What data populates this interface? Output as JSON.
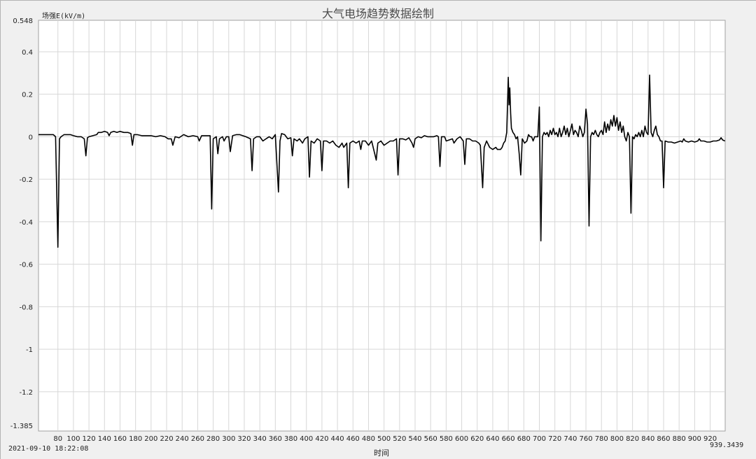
{
  "window": {
    "title": "大气电场趋势数据绘制",
    "timestamp": "2021-09-10 18:22:08"
  },
  "colors": {
    "background": "#f0f0f0",
    "plot_background": "#ffffff",
    "grid": "#d7d7d7",
    "line": "#000000"
  },
  "chart_data": {
    "type": "line",
    "title": "大气电场趋势数据绘制",
    "ylabel": "场强E(kV/m)",
    "xlabel": "时间",
    "xlim": [
      55,
      939.3439
    ],
    "ylim": [
      -1.385,
      0.548
    ],
    "x_max_label": "939.3439",
    "y_top_label": "0.548",
    "y_bottom_label": "-1.385",
    "x_ticks": [
      80,
      100,
      120,
      140,
      160,
      180,
      200,
      220,
      240,
      260,
      280,
      300,
      320,
      340,
      360,
      380,
      400,
      420,
      440,
      460,
      480,
      500,
      520,
      540,
      560,
      580,
      600,
      620,
      640,
      660,
      680,
      700,
      720,
      740,
      760,
      780,
      800,
      820,
      840,
      860,
      880,
      900,
      920
    ],
    "y_ticks": [
      0.4,
      0.2,
      0,
      -0.2,
      -0.4,
      -0.6,
      -0.8,
      -1,
      -1.2
    ],
    "y_tick_labels": [
      "0.4",
      "0.2",
      "0",
      "-0.2",
      "-0.4",
      "-0.6",
      "-0.8",
      "-1",
      "-1.2"
    ],
    "grid": true,
    "series": [
      {
        "points": [
          [
            55,
            0.01
          ],
          [
            60,
            0.01
          ],
          [
            65,
            0.01
          ],
          [
            70,
            0.01
          ],
          [
            74,
            0.01
          ],
          [
            77,
            0.0
          ],
          [
            80,
            -0.52
          ],
          [
            82,
            -0.01
          ],
          [
            84,
            0.0
          ],
          [
            88,
            0.01
          ],
          [
            92,
            0.01
          ],
          [
            96,
            0.01
          ],
          [
            100,
            0.005
          ],
          [
            105,
            0.0
          ],
          [
            110,
            0.0
          ],
          [
            114,
            -0.01
          ],
          [
            116,
            -0.09
          ],
          [
            118,
            -0.005
          ],
          [
            120,
            0.0
          ],
          [
            125,
            0.005
          ],
          [
            130,
            0.01
          ],
          [
            132,
            0.02
          ],
          [
            136,
            0.02
          ],
          [
            140,
            0.025
          ],
          [
            144,
            0.02
          ],
          [
            146,
            0.005
          ],
          [
            148,
            0.02
          ],
          [
            152,
            0.025
          ],
          [
            156,
            0.02
          ],
          [
            160,
            0.025
          ],
          [
            165,
            0.02
          ],
          [
            170,
            0.02
          ],
          [
            174,
            0.015
          ],
          [
            176,
            -0.04
          ],
          [
            178,
            0.01
          ],
          [
            182,
            0.01
          ],
          [
            188,
            0.005
          ],
          [
            194,
            0.005
          ],
          [
            200,
            0.005
          ],
          [
            206,
            0.0
          ],
          [
            212,
            0.005
          ],
          [
            218,
            0.0
          ],
          [
            222,
            -0.01
          ],
          [
            226,
            -0.01
          ],
          [
            228,
            -0.04
          ],
          [
            231,
            0.0
          ],
          [
            236,
            -0.005
          ],
          [
            242,
            0.01
          ],
          [
            248,
            0.0
          ],
          [
            254,
            0.005
          ],
          [
            260,
            0.0
          ],
          [
            262,
            -0.02
          ],
          [
            265,
            0.005
          ],
          [
            270,
            0.005
          ],
          [
            276,
            0.005
          ],
          [
            278,
            -0.34
          ],
          [
            280,
            -0.01
          ],
          [
            284,
            0.0
          ],
          [
            286,
            -0.08
          ],
          [
            288,
            -0.01
          ],
          [
            292,
            0.0
          ],
          [
            294,
            -0.02
          ],
          [
            297,
            0.0
          ],
          [
            300,
            0.0
          ],
          [
            302,
            -0.07
          ],
          [
            305,
            0.005
          ],
          [
            310,
            0.01
          ],
          [
            314,
            0.01
          ],
          [
            318,
            0.005
          ],
          [
            322,
            0.0
          ],
          [
            328,
            -0.01
          ],
          [
            330,
            -0.16
          ],
          [
            332,
            -0.01
          ],
          [
            336,
            0.0
          ],
          [
            340,
            0.0
          ],
          [
            344,
            -0.02
          ],
          [
            348,
            -0.01
          ],
          [
            352,
            0.0
          ],
          [
            356,
            -0.01
          ],
          [
            360,
            0.01
          ],
          [
            364,
            -0.26
          ],
          [
            366,
            -0.02
          ],
          [
            368,
            0.015
          ],
          [
            372,
            0.01
          ],
          [
            376,
            -0.01
          ],
          [
            380,
            -0.005
          ],
          [
            382,
            -0.09
          ],
          [
            384,
            -0.01
          ],
          [
            388,
            -0.02
          ],
          [
            391,
            -0.01
          ],
          [
            395,
            -0.03
          ],
          [
            398,
            -0.01
          ],
          [
            402,
            0.0
          ],
          [
            404,
            -0.19
          ],
          [
            406,
            -0.02
          ],
          [
            410,
            -0.03
          ],
          [
            414,
            -0.01
          ],
          [
            418,
            -0.02
          ],
          [
            420,
            -0.16
          ],
          [
            422,
            -0.02
          ],
          [
            426,
            -0.02
          ],
          [
            430,
            -0.03
          ],
          [
            434,
            -0.02
          ],
          [
            438,
            -0.04
          ],
          [
            442,
            -0.05
          ],
          [
            446,
            -0.03
          ],
          [
            448,
            -0.05
          ],
          [
            452,
            -0.03
          ],
          [
            454,
            -0.24
          ],
          [
            456,
            -0.03
          ],
          [
            460,
            -0.02
          ],
          [
            464,
            -0.03
          ],
          [
            468,
            -0.02
          ],
          [
            470,
            -0.06
          ],
          [
            472,
            -0.02
          ],
          [
            476,
            -0.02
          ],
          [
            480,
            -0.04
          ],
          [
            484,
            -0.02
          ],
          [
            488,
            -0.08
          ],
          [
            490,
            -0.11
          ],
          [
            492,
            -0.03
          ],
          [
            496,
            -0.02
          ],
          [
            500,
            -0.04
          ],
          [
            504,
            -0.03
          ],
          [
            508,
            -0.02
          ],
          [
            512,
            -0.02
          ],
          [
            516,
            -0.01
          ],
          [
            518,
            -0.18
          ],
          [
            520,
            -0.01
          ],
          [
            524,
            -0.01
          ],
          [
            528,
            -0.015
          ],
          [
            532,
            -0.005
          ],
          [
            536,
            -0.03
          ],
          [
            538,
            -0.05
          ],
          [
            540,
            -0.01
          ],
          [
            544,
            0.0
          ],
          [
            548,
            -0.005
          ],
          [
            552,
            0.005
          ],
          [
            556,
            0.0
          ],
          [
            560,
            0.0
          ],
          [
            564,
            0.0
          ],
          [
            568,
            0.005
          ],
          [
            570,
            0.0
          ],
          [
            572,
            -0.14
          ],
          [
            574,
            0.0
          ],
          [
            578,
            0.0
          ],
          [
            580,
            -0.02
          ],
          [
            584,
            -0.015
          ],
          [
            588,
            -0.01
          ],
          [
            590,
            -0.03
          ],
          [
            594,
            -0.01
          ],
          [
            598,
            0.0
          ],
          [
            602,
            -0.02
          ],
          [
            604,
            -0.13
          ],
          [
            606,
            -0.01
          ],
          [
            610,
            -0.01
          ],
          [
            614,
            -0.02
          ],
          [
            618,
            -0.02
          ],
          [
            622,
            -0.03
          ],
          [
            624,
            -0.04
          ],
          [
            627,
            -0.24
          ],
          [
            629,
            -0.05
          ],
          [
            632,
            -0.02
          ],
          [
            636,
            -0.05
          ],
          [
            640,
            -0.06
          ],
          [
            644,
            -0.05
          ],
          [
            646,
            -0.06
          ],
          [
            650,
            -0.06
          ],
          [
            652,
            -0.05
          ],
          [
            654,
            -0.03
          ],
          [
            656,
            -0.02
          ],
          [
            658,
            0.02
          ],
          [
            660,
            0.28
          ],
          [
            661,
            0.15
          ],
          [
            662,
            0.23
          ],
          [
            663,
            0.11
          ],
          [
            664,
            0.04
          ],
          [
            666,
            0.02
          ],
          [
            668,
            0.01
          ],
          [
            670,
            -0.01
          ],
          [
            672,
            0.0
          ],
          [
            674,
            -0.08
          ],
          [
            676,
            -0.18
          ],
          [
            678,
            -0.01
          ],
          [
            681,
            -0.03
          ],
          [
            684,
            -0.02
          ],
          [
            686,
            0.01
          ],
          [
            688,
            0.0
          ],
          [
            690,
            0.0
          ],
          [
            692,
            -0.02
          ],
          [
            694,
            0.0
          ],
          [
            698,
            0.0
          ],
          [
            700,
            0.14
          ],
          [
            702,
            -0.49
          ],
          [
            704,
            0.0
          ],
          [
            706,
            0.02
          ],
          [
            708,
            0.01
          ],
          [
            710,
            0.02
          ],
          [
            712,
            0.0
          ],
          [
            714,
            0.03
          ],
          [
            716,
            0.01
          ],
          [
            718,
            0.04
          ],
          [
            720,
            0.01
          ],
          [
            722,
            0.02
          ],
          [
            724,
            0.0
          ],
          [
            726,
            0.04
          ],
          [
            728,
            0.0
          ],
          [
            730,
            0.02
          ],
          [
            732,
            0.05
          ],
          [
            734,
            0.01
          ],
          [
            736,
            0.04
          ],
          [
            738,
            0.0
          ],
          [
            740,
            0.03
          ],
          [
            742,
            0.06
          ],
          [
            744,
            0.01
          ],
          [
            746,
            0.03
          ],
          [
            748,
            0.02
          ],
          [
            750,
            0.0
          ],
          [
            752,
            0.05
          ],
          [
            754,
            0.03
          ],
          [
            756,
            0.0
          ],
          [
            758,
            0.02
          ],
          [
            760,
            0.13
          ],
          [
            762,
            0.06
          ],
          [
            764,
            -0.42
          ],
          [
            766,
            0.0
          ],
          [
            768,
            0.02
          ],
          [
            770,
            0.01
          ],
          [
            772,
            0.03
          ],
          [
            774,
            0.01
          ],
          [
            776,
            0.0
          ],
          [
            778,
            0.02
          ],
          [
            780,
            0.03
          ],
          [
            782,
            0.01
          ],
          [
            784,
            0.07
          ],
          [
            786,
            0.02
          ],
          [
            788,
            0.06
          ],
          [
            790,
            0.03
          ],
          [
            792,
            0.08
          ],
          [
            794,
            0.05
          ],
          [
            796,
            0.1
          ],
          [
            798,
            0.05
          ],
          [
            800,
            0.09
          ],
          [
            802,
            0.03
          ],
          [
            804,
            0.07
          ],
          [
            806,
            0.02
          ],
          [
            808,
            0.05
          ],
          [
            810,
            0.0
          ],
          [
            812,
            -0.02
          ],
          [
            814,
            0.02
          ],
          [
            816,
            0.0
          ],
          [
            818,
            -0.36
          ],
          [
            820,
            0.0
          ],
          [
            822,
            -0.01
          ],
          [
            824,
            0.01
          ],
          [
            826,
            0.0
          ],
          [
            828,
            0.02
          ],
          [
            830,
            0.0
          ],
          [
            832,
            0.03
          ],
          [
            834,
            0.0
          ],
          [
            836,
            0.05
          ],
          [
            838,
            0.02
          ],
          [
            840,
            0.01
          ],
          [
            842,
            0.29
          ],
          [
            844,
            0.02
          ],
          [
            846,
            0.0
          ],
          [
            848,
            0.03
          ],
          [
            850,
            0.05
          ],
          [
            852,
            0.01
          ],
          [
            854,
            0.0
          ],
          [
            856,
            -0.02
          ],
          [
            858,
            -0.02
          ],
          [
            860,
            -0.24
          ],
          [
            862,
            -0.02
          ],
          [
            866,
            -0.025
          ],
          [
            870,
            -0.025
          ],
          [
            874,
            -0.03
          ],
          [
            878,
            -0.025
          ],
          [
            882,
            -0.02
          ],
          [
            884,
            -0.025
          ],
          [
            886,
            -0.01
          ],
          [
            888,
            -0.02
          ],
          [
            892,
            -0.025
          ],
          [
            896,
            -0.02
          ],
          [
            900,
            -0.025
          ],
          [
            904,
            -0.02
          ],
          [
            906,
            -0.01
          ],
          [
            908,
            -0.02
          ],
          [
            912,
            -0.02
          ],
          [
            916,
            -0.025
          ],
          [
            920,
            -0.025
          ],
          [
            924,
            -0.02
          ],
          [
            928,
            -0.02
          ],
          [
            932,
            -0.015
          ],
          [
            934,
            -0.005
          ],
          [
            936,
            -0.015
          ],
          [
            939,
            -0.02
          ]
        ]
      }
    ]
  }
}
